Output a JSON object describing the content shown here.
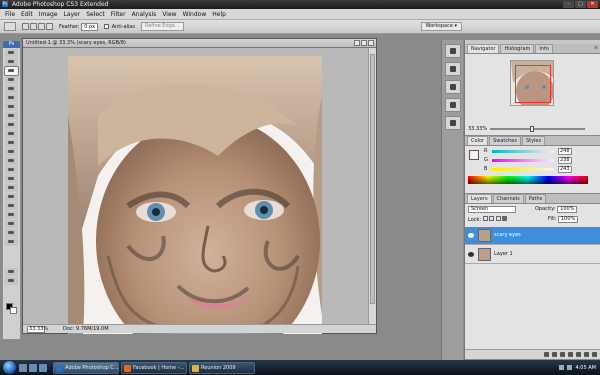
{
  "window": {
    "title": "Adobe Photoshop CS3 Extended",
    "app_icon": "Ps",
    "minimize": "–",
    "maximize": "□",
    "close": "✕"
  },
  "menu": [
    "File",
    "Edit",
    "Image",
    "Layer",
    "Select",
    "Filter",
    "Analysis",
    "View",
    "Window",
    "Help"
  ],
  "options": {
    "feather_label": "Feather:",
    "feather_value": "0 px",
    "antialias_label": "Anti-alias",
    "refine_edge": "Refine Edge...",
    "workspace": "Workspace ▾"
  },
  "document": {
    "title": "Untitled-1 @ 33.3% (scary eyes, RGB/8)",
    "zoom": "33.33%",
    "doc_info": "Doc: 9.76M/19.0M"
  },
  "navigator": {
    "tabs": [
      "Navigator",
      "Histogram",
      "Info"
    ],
    "zoom": "33.33%",
    "zoom_fraction": 0.42
  },
  "color": {
    "tabs": [
      "Color",
      "Swatches",
      "Styles"
    ],
    "channels": [
      {
        "label": "R",
        "value": "248",
        "level": 0.973
      },
      {
        "label": "G",
        "value": "238",
        "level": 0.933
      },
      {
        "label": "B",
        "value": "243",
        "level": 0.953
      }
    ],
    "foreground": "#f8eef3"
  },
  "layers": {
    "tabs": [
      "Layers",
      "Channels",
      "Paths"
    ],
    "blend_mode": "Screen",
    "opacity_label": "Opacity:",
    "opacity_value": "100%",
    "lock_label": "Lock:",
    "fill_label": "Fill:",
    "fill_value": "100%",
    "items": [
      {
        "name": "scary eyes",
        "selected": true
      },
      {
        "name": "Layer 1",
        "selected": false
      }
    ]
  },
  "taskbar": {
    "tasks": [
      {
        "label": "Adobe Photoshop C...",
        "icon_color": "#2a6fb8",
        "active": true
      },
      {
        "label": "Facebook | Home -...",
        "icon_color": "#e06b1f",
        "active": false
      },
      {
        "label": "Reunion 2009",
        "icon_color": "#d9b34a",
        "active": false
      }
    ],
    "clock": "4:05 AM"
  },
  "colors": {
    "selection_blue": "#3f8edc"
  }
}
